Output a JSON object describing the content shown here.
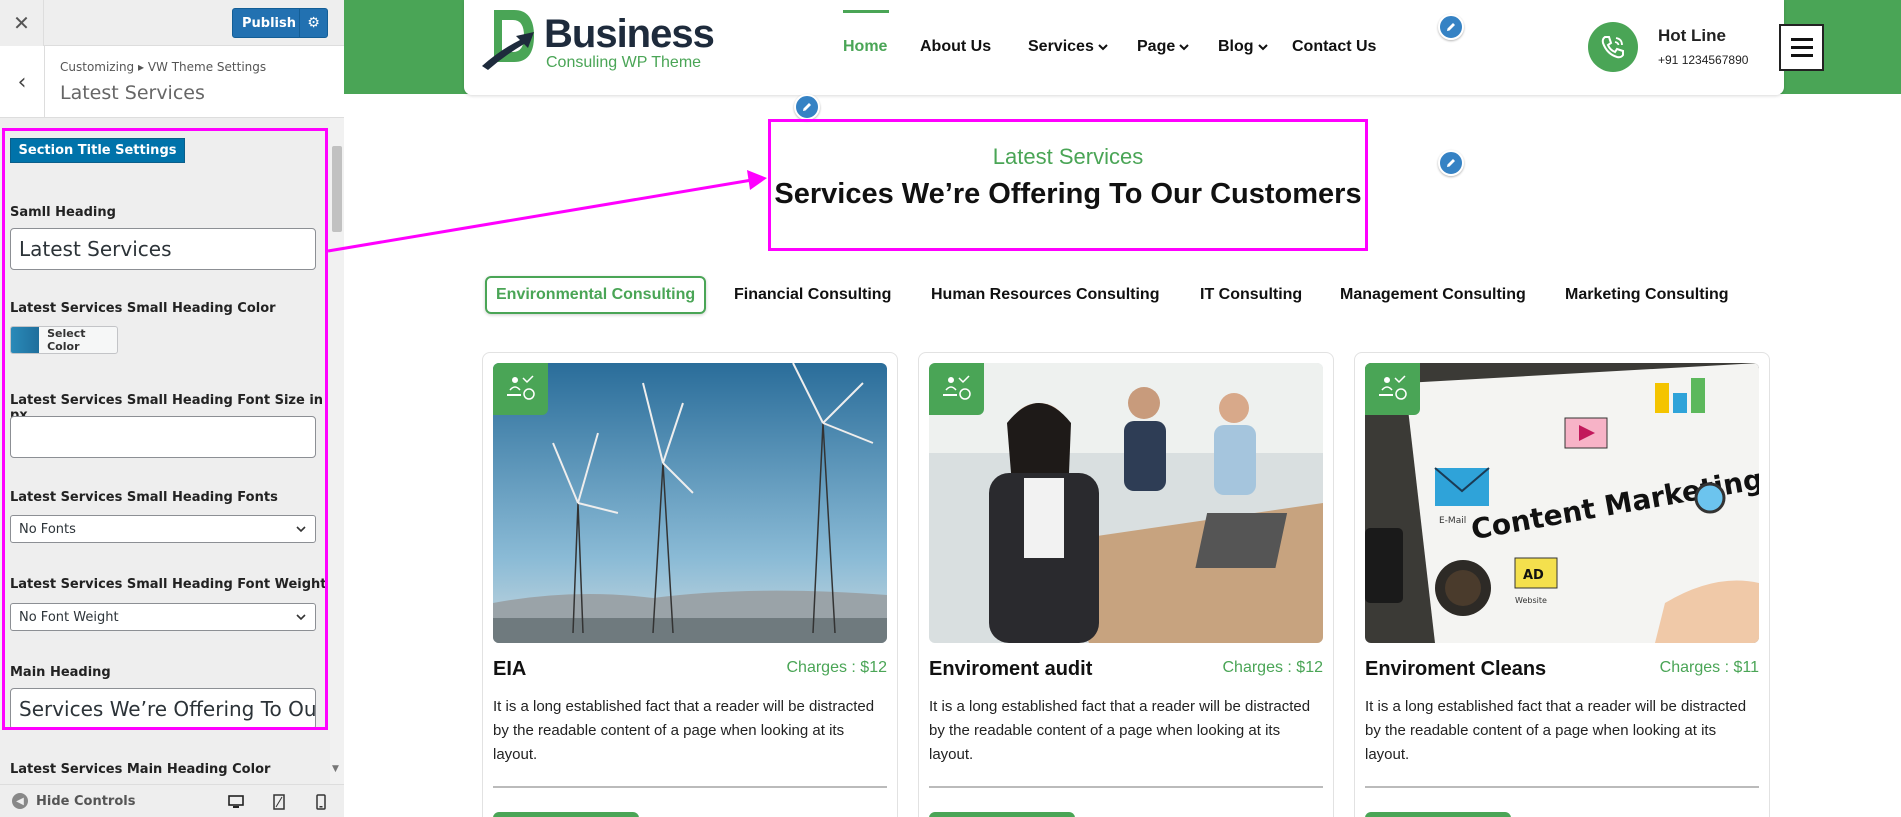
{
  "customizer": {
    "close_icon": "close-icon",
    "publish_label": "Publish",
    "breadcrumb": "Customizing ▸ VW Theme Settings",
    "section_name": "Latest Services",
    "section_title_badge": "Section Title Settings",
    "fields": {
      "small_heading_label": "Samll Heading",
      "small_heading_value": "Latest Services",
      "small_heading_color_label": "Latest Services Small Heading Color",
      "select_color_label": "Select Color",
      "small_heading_font_size_label": "Latest Services Small Heading Font Size in px",
      "small_heading_font_size_value": "",
      "small_heading_fonts_label": "Latest Services Small Heading Fonts",
      "small_heading_fonts_value": "No Fonts",
      "small_heading_font_weight_label": "Latest Services Small Heading Font Weight",
      "small_heading_font_weight_value": "No Font Weight",
      "main_heading_label": "Main Heading",
      "main_heading_value": "Services We’re Offering To Our Customers",
      "main_heading_color_label": "Latest Services Main Heading Color"
    },
    "footer": {
      "hide_controls": "Hide Controls"
    },
    "highlight_color": "#ff00ff",
    "accent_color": "#2271b1"
  },
  "site": {
    "logo_title": "Business",
    "logo_subtitle": "Consuling WP Theme",
    "nav": [
      {
        "label": "Home"
      },
      {
        "label": "About Us"
      },
      {
        "label": "Services"
      },
      {
        "label": "Page"
      },
      {
        "label": "Blog"
      },
      {
        "label": "Contact Us"
      }
    ],
    "hotline_label": "Hot Line",
    "hotline_number": "+91 1234567890",
    "small_heading": "Latest Services",
    "main_heading": "Services We’re Offering To Our Customers",
    "tabs": [
      {
        "label": "Environmental Consulting"
      },
      {
        "label": "Financial Consulting"
      },
      {
        "label": "Human Resources Consulting"
      },
      {
        "label": "IT Consulting"
      },
      {
        "label": "Management Consulting"
      },
      {
        "label": "Marketing Consulting"
      }
    ],
    "cards": [
      {
        "title": "EIA",
        "charges": "Charges : $12",
        "description": "It is a long established fact that a reader will be distracted by the readable content of a page when looking at its layout."
      },
      {
        "title": "Enviroment audit",
        "charges": "Charges : $12",
        "description": "It is a long established fact that a reader will be distracted by the readable content of a page when looking at its layout."
      },
      {
        "title": "Enviroment Cleans",
        "charges": "Charges : $11",
        "description": "It is a long established fact that a reader will be distracted by the readable content of a page when looking at its layout."
      }
    ],
    "card_image_text": {
      "content_marketing": "Content Marketing",
      "email": "E-Mail",
      "ad": "AD",
      "website": "Website"
    },
    "brand_green": "#4aa556"
  }
}
